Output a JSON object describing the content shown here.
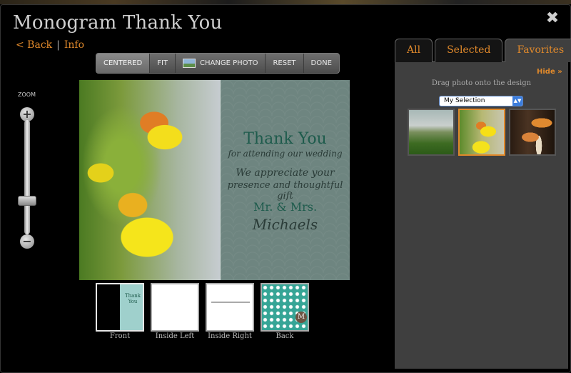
{
  "window": {
    "title": "Monogram Thank You",
    "close_glyph": "✖"
  },
  "nav": {
    "back": "< Back",
    "separator": "|",
    "info": "Info"
  },
  "toolbar": {
    "centered": "CENTERED",
    "fit": "FIT",
    "change_photo": "CHANGE PHOTO",
    "reset": "RESET",
    "done": "DONE",
    "active": "centered"
  },
  "zoom": {
    "label": "ZOOM",
    "plus": "+",
    "minus": "−",
    "level": 0.35
  },
  "card": {
    "heading": "Thank You",
    "line1": "for attending our wedding",
    "line2": "We appreciate your",
    "line3": "presence and thoughtful gift",
    "names1": "Mr. & Mrs.",
    "names2": "Michaels",
    "accent_color": "#1e5b4c",
    "panel_color": "#6e8580"
  },
  "pages": [
    {
      "label": "Front",
      "selected": true,
      "mini_title": "Thank You"
    },
    {
      "label": "Inside Left",
      "selected": false
    },
    {
      "label": "Inside Right",
      "selected": false
    },
    {
      "label": "Back",
      "selected": false,
      "monogram": "M"
    }
  ],
  "sidebar": {
    "tabs": [
      "All",
      "Selected",
      "Favorites"
    ],
    "active_tab": "Favorites",
    "hide": "Hide »",
    "instruction": "Drag photo onto the design",
    "select_value": "My Selection",
    "thumbnails": [
      {
        "name": "landscape",
        "selected": false
      },
      {
        "name": "yellow-orchid",
        "selected": true
      },
      {
        "name": "mushrooms",
        "selected": false
      }
    ]
  },
  "colors": {
    "accent": "#e0892b",
    "panel": "#3f3f3f",
    "background": "#000000"
  }
}
